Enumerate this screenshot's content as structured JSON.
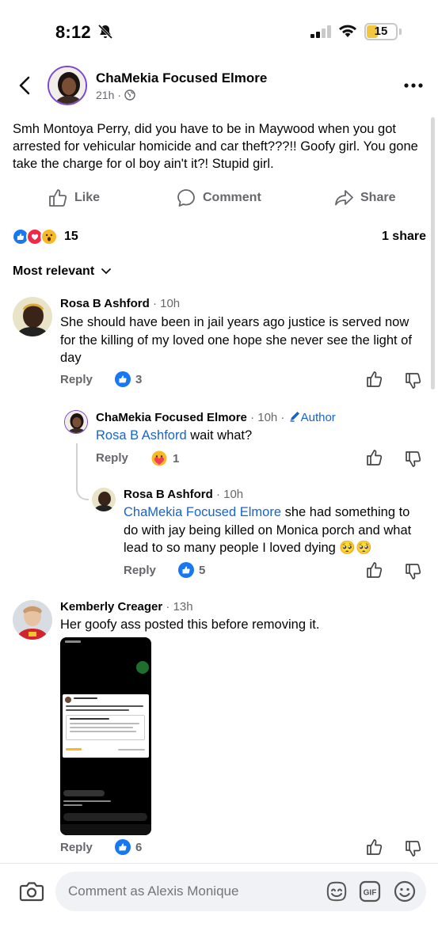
{
  "status": {
    "time": "8:12",
    "battery": "15",
    "battery_level": 0.15
  },
  "header": {
    "author": "ChaMekia Focused Elmore",
    "age": "21h",
    "age_suffix": " ·"
  },
  "post": {
    "text": "Smh Montoya Perry, did you have to be in Maywood when you got arrested for vehicular homicide and car theft???!!  Goofy girl. You gone take the charge for ol boy ain't it?! Stupid girl.",
    "actions": {
      "like": "Like",
      "comment": "Comment",
      "share": "Share"
    },
    "reaction_count": "15",
    "share_count": "1 share"
  },
  "sort_label": "Most relevant",
  "comments": [
    {
      "name": "Rosa B Ashford",
      "time": " · 10h",
      "text": "She should have been in jail years ago justice is served now for the killing of my loved one hope she never see the light of day",
      "reply_label": "Reply",
      "reactions": "3"
    },
    {
      "name": "ChaMekia Focused Elmore",
      "time": " · 10h · ",
      "badge": "Author",
      "mention": "Rosa B Ashford",
      "text": " wait what?",
      "reply_label": "Reply",
      "reactions": "1"
    },
    {
      "name": "Rosa B Ashford",
      "time": " · 10h",
      "mention": "ChaMekia Focused Elmore",
      "text": " she had something to do with jay being killed on Monica porch and what lead to so many people I loved dying 🥺🥺",
      "reply_label": "Reply",
      "reactions": "5"
    },
    {
      "name": "Kemberly Creager",
      "time": " · 13h",
      "text": "Her goofy ass posted this before removing it.",
      "reply_label": "Reply",
      "reactions": "6"
    }
  ],
  "composer": {
    "placeholder": "Comment as Alexis Monique"
  },
  "colors": {
    "accent": "#1877f2",
    "mention": "#1763cf",
    "secondary_text": "#65676b"
  }
}
